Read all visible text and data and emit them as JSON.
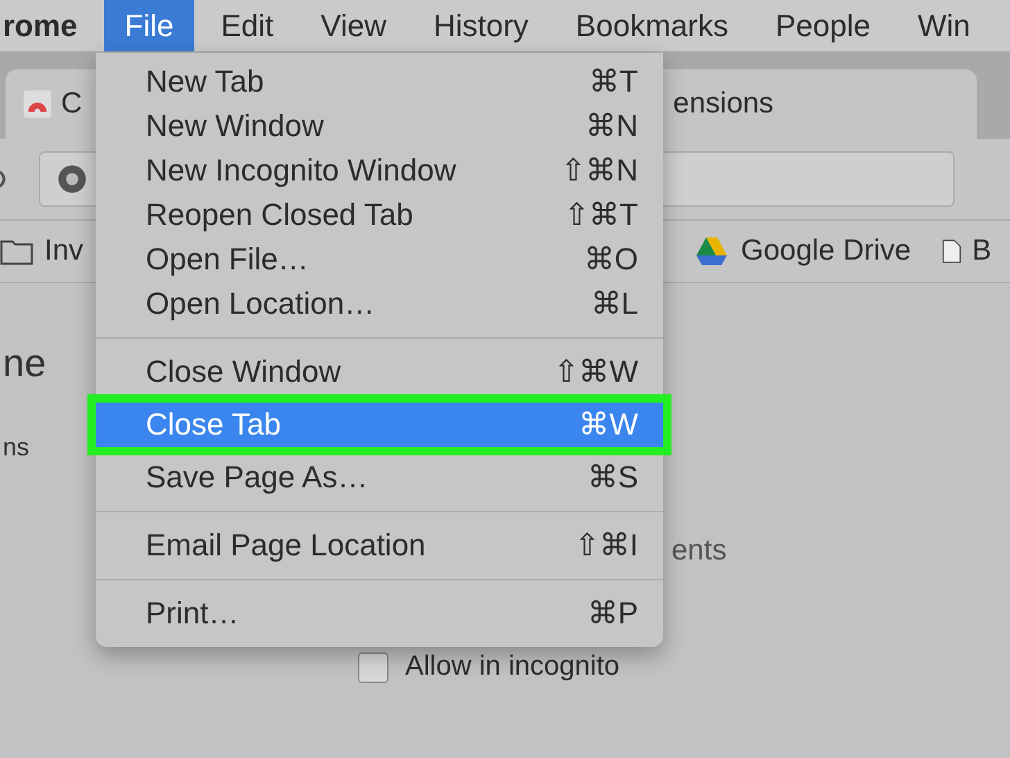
{
  "menu_bar": [
    {
      "label": "rome",
      "selected": false,
      "kind": "app"
    },
    {
      "label": "File",
      "selected": true,
      "kind": "menu"
    },
    {
      "label": "Edit",
      "selected": false,
      "kind": "menu"
    },
    {
      "label": "View",
      "selected": false,
      "kind": "menu"
    },
    {
      "label": "History",
      "selected": false,
      "kind": "menu"
    },
    {
      "label": "Bookmarks",
      "selected": false,
      "kind": "menu"
    },
    {
      "label": "People",
      "selected": false,
      "kind": "menu"
    },
    {
      "label": "Win",
      "selected": false,
      "kind": "menu"
    }
  ],
  "tab": {
    "title_start": "C",
    "title_end": "ensions"
  },
  "bookmarks": [
    {
      "label": "Inv",
      "kind": "folder"
    },
    {
      "label": "Google Drive",
      "kind": "drive"
    },
    {
      "label": "B",
      "kind": "page"
    }
  ],
  "page": {
    "heading": "ne",
    "side_text": "ns",
    "section_text": "ents",
    "incognito": {
      "label": "Allow in incognito",
      "checked": false
    }
  },
  "file_menu": [
    {
      "kind": "item",
      "label": "New Tab",
      "shortcut": "⌘T",
      "selected": false
    },
    {
      "kind": "item",
      "label": "New Window",
      "shortcut": "⌘N",
      "selected": false
    },
    {
      "kind": "item",
      "label": "New Incognito Window",
      "shortcut": "⇧⌘N",
      "selected": false
    },
    {
      "kind": "item",
      "label": "Reopen Closed Tab",
      "shortcut": "⇧⌘T",
      "selected": false
    },
    {
      "kind": "item",
      "label": "Open File…",
      "shortcut": "⌘O",
      "selected": false
    },
    {
      "kind": "item",
      "label": "Open Location…",
      "shortcut": "⌘L",
      "selected": false
    },
    {
      "kind": "separator"
    },
    {
      "kind": "item",
      "label": "Close Window",
      "shortcut": "⇧⌘W",
      "selected": false
    },
    {
      "kind": "item",
      "label": "Close Tab",
      "shortcut": "⌘W",
      "selected": true
    },
    {
      "kind": "item",
      "label": "Save Page As…",
      "shortcut": "⌘S",
      "selected": false
    },
    {
      "kind": "separator"
    },
    {
      "kind": "item",
      "label": "Email Page Location",
      "shortcut": "⇧⌘I",
      "selected": false
    },
    {
      "kind": "separator"
    },
    {
      "kind": "item",
      "label": "Print…",
      "shortcut": "⌘P",
      "selected": false
    }
  ]
}
